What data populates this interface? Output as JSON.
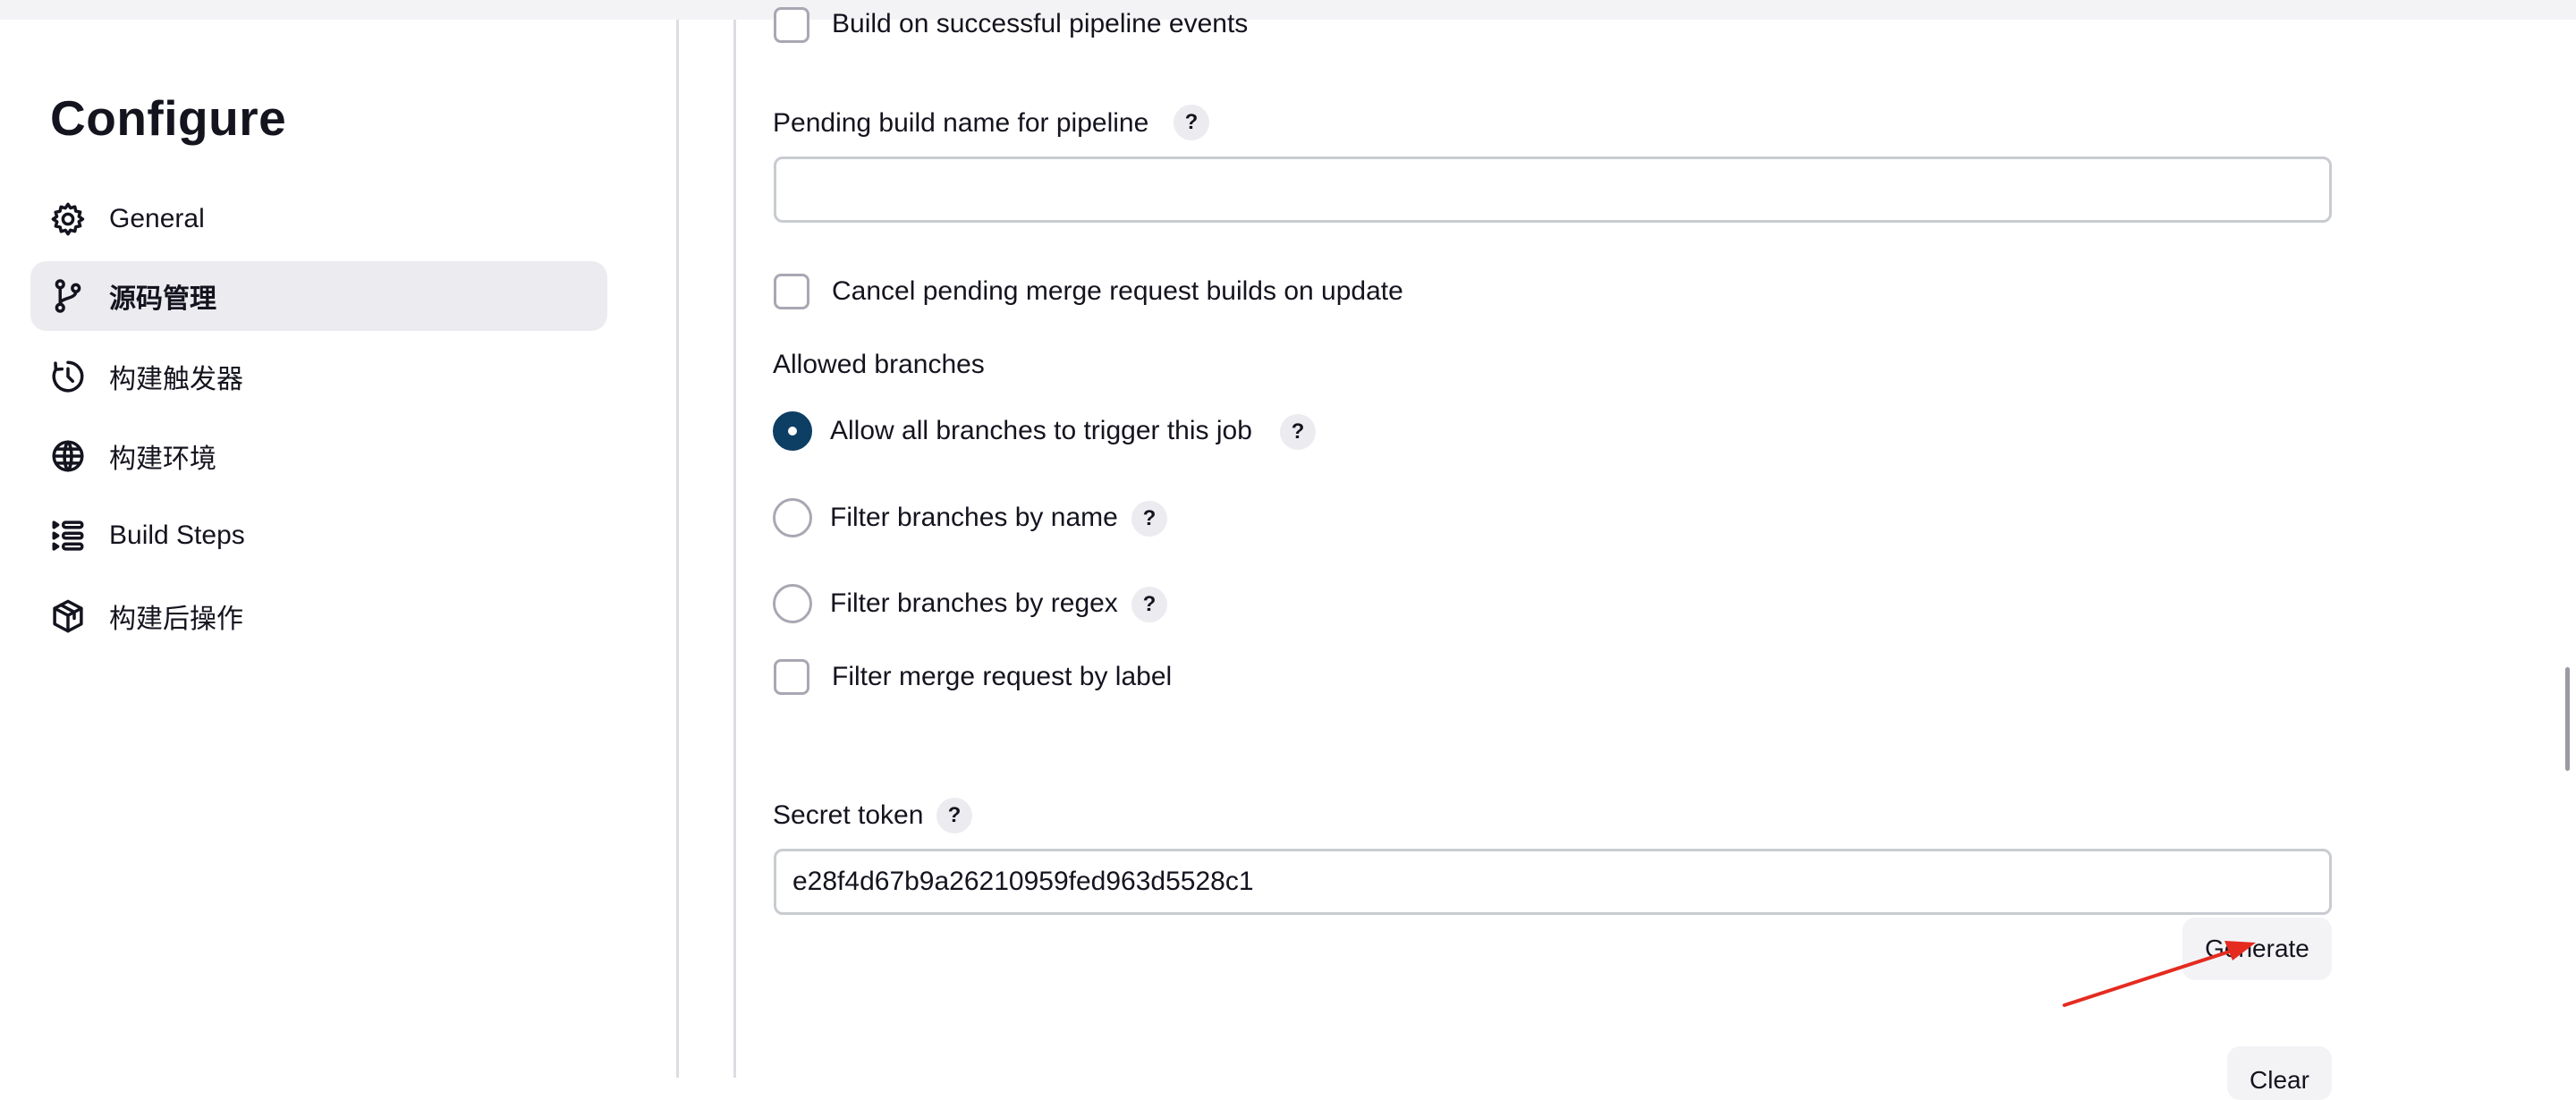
{
  "sidebar": {
    "title": "Configure",
    "items": [
      {
        "label": "General",
        "icon": "gear-icon"
      },
      {
        "label": "源码管理",
        "icon": "source-branch-icon",
        "active": true
      },
      {
        "label": "构建触发器",
        "icon": "clock-trigger-icon"
      },
      {
        "label": "构建环境",
        "icon": "globe-icon"
      },
      {
        "label": "Build Steps",
        "icon": "list-steps-icon"
      },
      {
        "label": "构建后操作",
        "icon": "package-icon"
      }
    ]
  },
  "main": {
    "build_on_pipeline_events_label": "Build on successful pipeline events",
    "pending_build_name_label": "Pending build name for pipeline",
    "pending_build_name_value": "",
    "cancel_pending_label": "Cancel pending merge request builds on update",
    "allowed_branches_heading": "Allowed branches",
    "allowed_branches_options": [
      {
        "label": "Allow all branches to trigger this job",
        "checked": true
      },
      {
        "label": "Filter branches by name",
        "checked": false
      },
      {
        "label": "Filter branches by regex",
        "checked": false
      }
    ],
    "filter_merge_request_label": "Filter merge request by label",
    "secret_token_label": "Secret token",
    "secret_token_value": "e28f4d67b9a26210959fed963d5528c1",
    "generate_button": "Generate",
    "clear_button": "Clear",
    "help_glyph": "?"
  },
  "colors": {
    "accent": "#0d3e63",
    "active_nav_bg": "#ebebf0",
    "annotation_arrow": "#e52b20"
  }
}
